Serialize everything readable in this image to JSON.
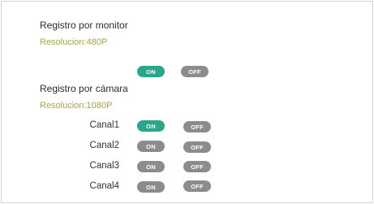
{
  "monitor": {
    "title": "Registro por monitor",
    "resolution": "Resolucion:480P",
    "on_label": "ON",
    "off_label": "OFF",
    "state": "on"
  },
  "camera": {
    "title": "Registro por cámara",
    "resolution": "Resolucion:1080P",
    "channels": [
      {
        "label": "Canal1",
        "on_label": "ON",
        "off_label": "OFF",
        "state": "on"
      },
      {
        "label": "Canal2",
        "on_label": "ON",
        "off_label": "OFF",
        "state": "off"
      },
      {
        "label": "Canal3",
        "on_label": "ON",
        "off_label": "OFF",
        "state": "off"
      },
      {
        "label": "Canal4",
        "on_label": "ON",
        "off_label": "OFF",
        "state": "off"
      }
    ]
  },
  "colors": {
    "active_toggle": "#2aa68a",
    "inactive_toggle": "#8c8c8c",
    "resolution_text": "#a8a53a"
  }
}
